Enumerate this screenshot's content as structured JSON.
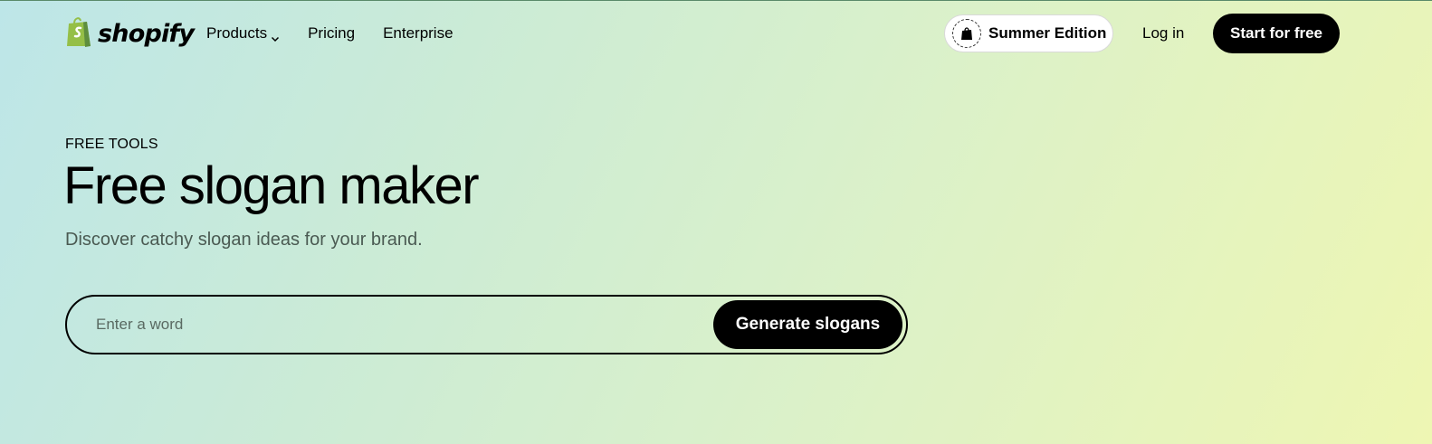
{
  "header": {
    "logo_text": "shopify",
    "nav": [
      {
        "label": "Products",
        "has_dropdown": true
      },
      {
        "label": "Pricing"
      },
      {
        "label": "Enterprise"
      }
    ],
    "edition_label": "Summer Edition",
    "login_label": "Log in",
    "cta_label": "Start for free"
  },
  "hero": {
    "eyebrow": "FREE TOOLS",
    "title": "Free slogan maker",
    "subtitle": "Discover catchy slogan ideas for your brand.",
    "input_placeholder": "Enter a word",
    "input_value": "",
    "submit_label": "Generate slogans"
  },
  "colors": {
    "brand_green": "#95bf47",
    "button_bg": "#000000",
    "button_text": "#ffffff"
  },
  "icons": {
    "logo": "shopify-bag-icon",
    "dropdown": "chevron-down-icon",
    "edition_badge": "shopify-edition-badge-icon"
  }
}
